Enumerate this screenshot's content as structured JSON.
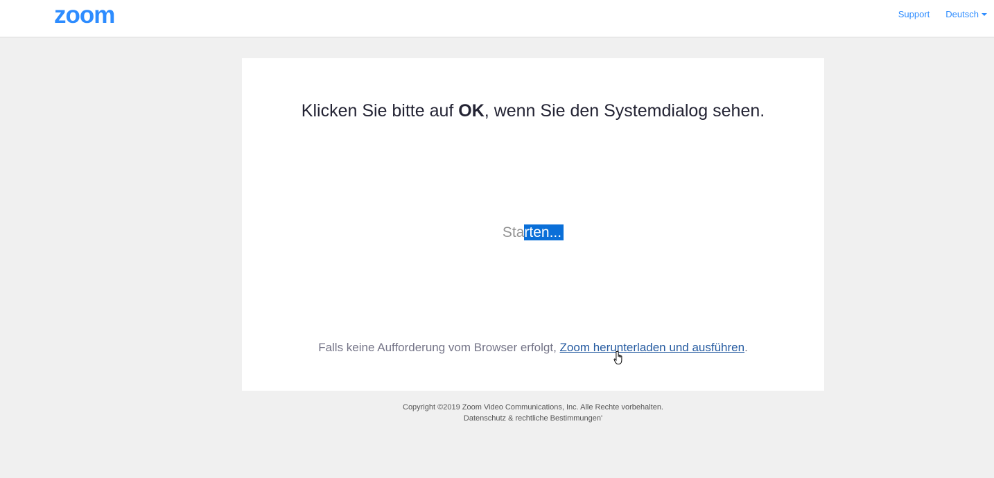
{
  "header": {
    "logo_text": "zoom",
    "support_label": "Support",
    "language_label": "Deutsch",
    "brand_color": "#2d8cff"
  },
  "main": {
    "headline_prefix": "Klicken Sie bitte auf ",
    "headline_bold": "OK",
    "headline_suffix": ", wenn Sie den Systemdialog sehen.",
    "status_plain": "Sta",
    "status_selected": "rten...",
    "fallback_text": "Falls keine Aufforderung vom Browser erfolgt, ",
    "fallback_link": "Zoom herunterladen und ausführen",
    "fallback_end": "."
  },
  "footer": {
    "copyright": "Copyright ©2019 Zoom Video Communications, Inc. Alle Rechte vorbehalten.",
    "privacy_link": "Datenschutz & rechtliche Bestimmungen'"
  }
}
